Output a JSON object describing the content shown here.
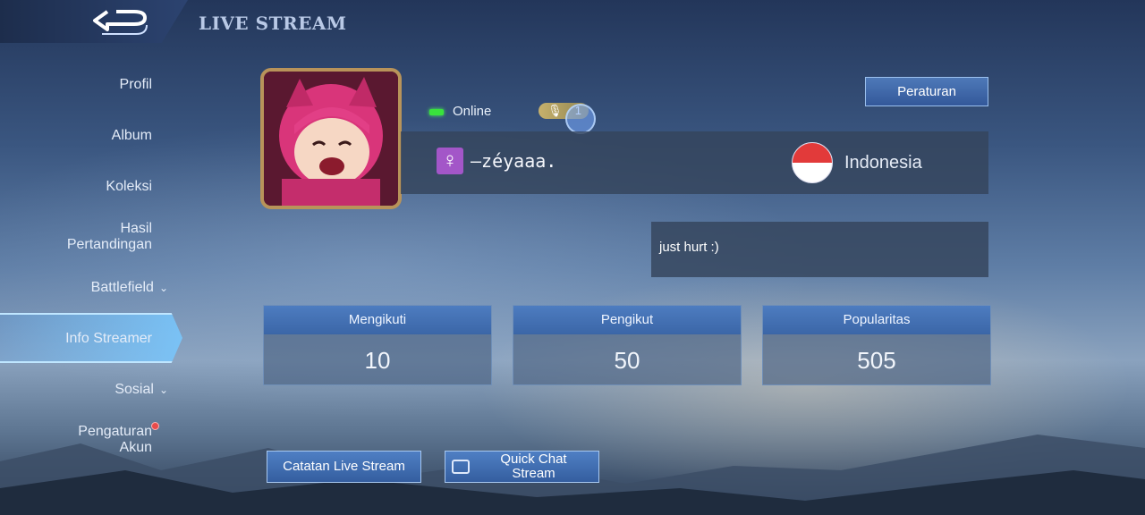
{
  "header": {
    "title": "LIVE STREAM"
  },
  "sidebar": {
    "items": [
      {
        "label": "Profil"
      },
      {
        "label": "Album"
      },
      {
        "label": "Koleksi"
      },
      {
        "label_line1": "Hasil",
        "label_line2": "Pertandingan"
      },
      {
        "label": "Battlefield",
        "has_chevron": true
      },
      {
        "label": "Info Streamer",
        "active": true
      },
      {
        "label": "Sosial",
        "has_chevron": true
      },
      {
        "label_line1": "Pengaturan",
        "label_line2": "Akun",
        "notification_dot": true
      }
    ]
  },
  "profile": {
    "status": "Online",
    "mic_count": "1",
    "username": "—zéyaaa.",
    "gender_symbol": "♀",
    "country": "Indonesia",
    "bio": "just hurt :)"
  },
  "rules_button": "Peraturan",
  "stats": [
    {
      "label": "Mengikuti",
      "value": "10"
    },
    {
      "label": "Pengikut",
      "value": "50"
    },
    {
      "label": "Popularitas",
      "value": "505"
    }
  ],
  "buttons": {
    "record": "Catatan Live Stream",
    "quick_chat_line1": "Quick Chat",
    "quick_chat_line2": "Stream"
  },
  "colors": {
    "accent_blue": "#3b66a7",
    "online_green": "#39e23c",
    "notification_red": "#e84b4b"
  },
  "icons": [
    "back-arrow-icon",
    "chevron-down-icon",
    "female-icon",
    "indonesia-flag-icon",
    "microphone-icon",
    "chat-bubble-icon"
  ]
}
